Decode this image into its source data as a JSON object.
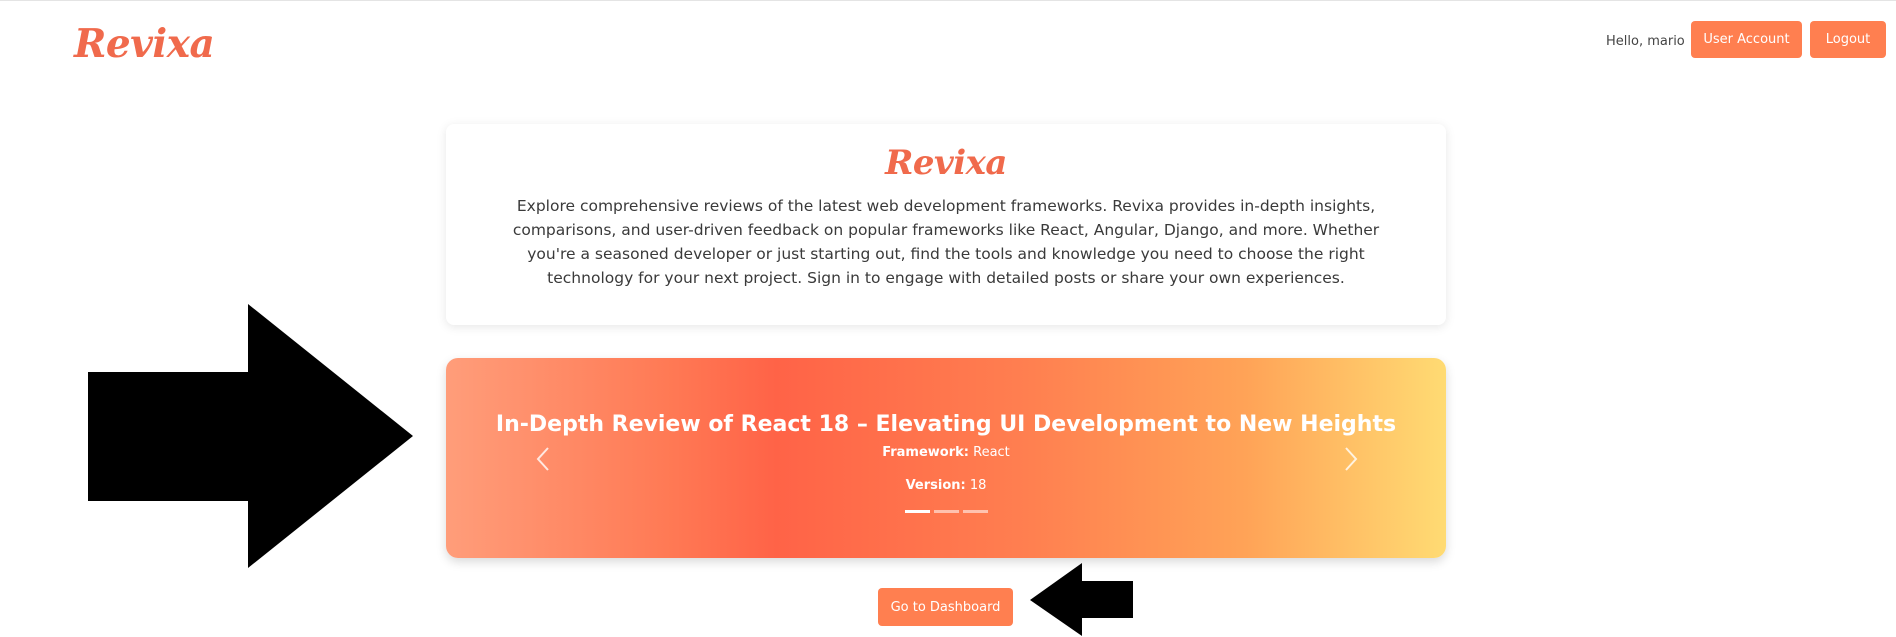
{
  "header": {
    "logo": "Revixa",
    "greeting": "Hello, mario",
    "user_account_label": "User Account",
    "logout_label": "Logout"
  },
  "intro": {
    "logo": "Revixa",
    "description": "Explore comprehensive reviews of the latest web development frameworks. Revixa provides in-depth insights, comparisons, and user-driven feedback on popular frameworks like React, Angular, Django, and more. Whether you're a seasoned developer or just starting out, find the tools and knowledge you need to choose the right technology for your next project. Sign in to engage with detailed posts or share your own experiences."
  },
  "carousel": {
    "title": "In-Depth Review of React 18 – Elevating UI Development to New Heights",
    "framework_label": "Framework:",
    "framework_value": "React",
    "version_label": "Version:",
    "version_value": "18",
    "slide_count": 3,
    "active_slide": 1,
    "prev_icon": "chevron-left-icon",
    "next_icon": "chevron-right-icon",
    "gradient_colors": [
      "#ff9d7a",
      "#ff6347",
      "#ff7f50",
      "#ffdb73"
    ]
  },
  "dashboard_button_label": "Go to Dashboard",
  "colors": {
    "accent": "#ff7f50",
    "logo": "#f06a4c"
  }
}
